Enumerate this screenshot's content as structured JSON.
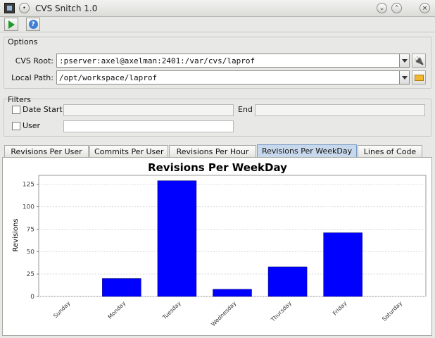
{
  "window": {
    "title": "CVS Snitch 1.0"
  },
  "toolbar": {
    "run_icon": "play-icon",
    "help_icon": "help-icon",
    "help_glyph": "?"
  },
  "options": {
    "section_title": "Options",
    "cvs_root_label": "CVS Root:",
    "cvs_root_value": ":pserver:axel@axelman:2401:/var/cvs/laprof",
    "local_path_label": "Local Path:",
    "local_path_value": "/opt/workspace/laprof"
  },
  "filters": {
    "section_title": "Filters",
    "date_start_label": "Date Start",
    "end_label": "End",
    "user_label": "User"
  },
  "tabs": [
    {
      "label": "Revisions Per User",
      "active": false
    },
    {
      "label": "Commits Per User",
      "active": false
    },
    {
      "label": "Revisions Per Hour",
      "active": false
    },
    {
      "label": "Revisions Per WeekDay",
      "active": true
    },
    {
      "label": "Lines of Code",
      "active": false
    }
  ],
  "colors": {
    "bar": "#0000ff",
    "active_tab": "#c8d8ec"
  },
  "chart_data": {
    "type": "bar",
    "title": "Revisions Per WeekDay",
    "xlabel": "",
    "ylabel": "Revisions",
    "categories": [
      "Sunday",
      "Monday",
      "Tuesday",
      "Wednesday",
      "Thursday",
      "Friday",
      "Saturday"
    ],
    "values": [
      0,
      20,
      129,
      8,
      33,
      71,
      0
    ],
    "yticks": [
      0,
      25,
      50,
      75,
      100,
      125
    ],
    "ylim": [
      0,
      135
    ],
    "grid": true
  }
}
